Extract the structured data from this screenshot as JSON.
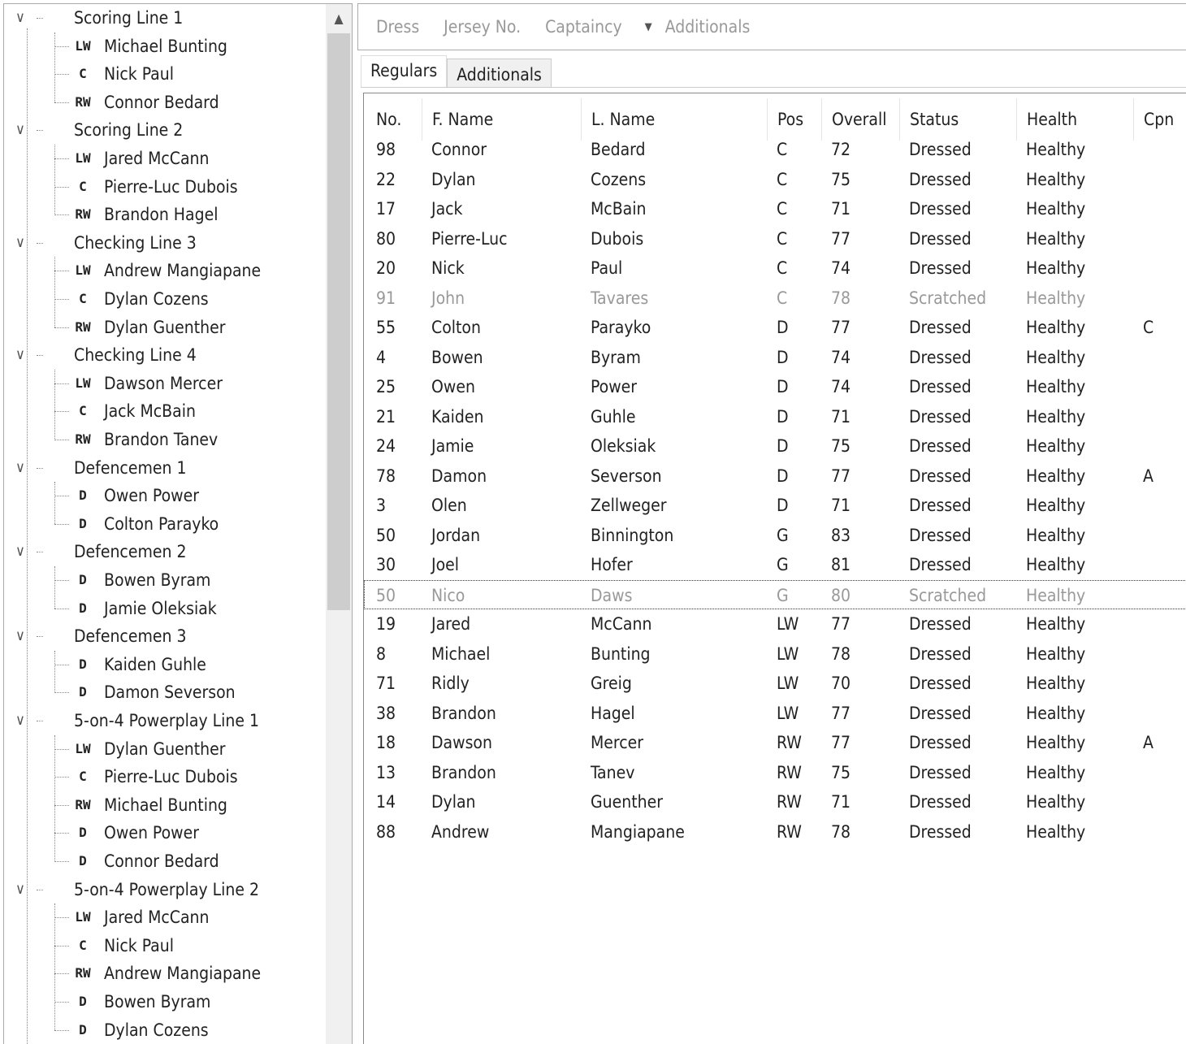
{
  "tree": [
    {
      "group": "Scoring Line 1",
      "players": [
        [
          "LW",
          "Michael Bunting"
        ],
        [
          "C",
          "Nick Paul"
        ],
        [
          "RW",
          "Connor Bedard"
        ]
      ]
    },
    {
      "group": "Scoring Line 2",
      "players": [
        [
          "LW",
          "Jared McCann"
        ],
        [
          "C",
          "Pierre-Luc Dubois"
        ],
        [
          "RW",
          "Brandon Hagel"
        ]
      ]
    },
    {
      "group": "Checking Line 3",
      "players": [
        [
          "LW",
          "Andrew Mangiapane"
        ],
        [
          "C",
          "Dylan Cozens"
        ],
        [
          "RW",
          "Dylan Guenther"
        ]
      ]
    },
    {
      "group": "Checking Line 4",
      "players": [
        [
          "LW",
          "Dawson Mercer"
        ],
        [
          "C",
          "Jack McBain"
        ],
        [
          "RW",
          "Brandon Tanev"
        ]
      ]
    },
    {
      "group": "Defencemen 1",
      "players": [
        [
          "D",
          "Owen Power"
        ],
        [
          "D",
          "Colton Parayko"
        ]
      ]
    },
    {
      "group": "Defencemen 2",
      "players": [
        [
          "D",
          "Bowen Byram"
        ],
        [
          "D",
          "Jamie Oleksiak"
        ]
      ]
    },
    {
      "group": "Defencemen 3",
      "players": [
        [
          "D",
          "Kaiden Guhle"
        ],
        [
          "D",
          "Damon Severson"
        ]
      ]
    },
    {
      "group": "5-on-4 Powerplay Line 1",
      "players": [
        [
          "LW",
          "Dylan Guenther"
        ],
        [
          "C",
          "Pierre-Luc Dubois"
        ],
        [
          "RW",
          "Michael Bunting"
        ],
        [
          "D",
          "Owen Power"
        ],
        [
          "D",
          "Connor Bedard"
        ]
      ]
    },
    {
      "group": "5-on-4 Powerplay Line 2",
      "players": [
        [
          "LW",
          "Jared McCann"
        ],
        [
          "C",
          "Nick Paul"
        ],
        [
          "RW",
          "Andrew Mangiapane"
        ],
        [
          "D",
          "Bowen Byram"
        ],
        [
          "D",
          "Dylan Cozens"
        ]
      ]
    }
  ],
  "toolbar": {
    "dress": "Dress",
    "jersey": "Jersey No.",
    "captaincy": "Captaincy",
    "additionals": "Additionals"
  },
  "tabs": [
    "Regulars",
    "Additionals"
  ],
  "columns": [
    "No.",
    "F. Name",
    "L. Name",
    "Pos",
    "Overall",
    "Status",
    "Health",
    "Cpn"
  ],
  "rows": [
    [
      "98",
      "Connor",
      "Bedard",
      "C",
      "72",
      "Dressed",
      "Healthy",
      ""
    ],
    [
      "22",
      "Dylan",
      "Cozens",
      "C",
      "75",
      "Dressed",
      "Healthy",
      ""
    ],
    [
      "17",
      "Jack",
      "McBain",
      "C",
      "71",
      "Dressed",
      "Healthy",
      ""
    ],
    [
      "80",
      "Pierre-Luc",
      "Dubois",
      "C",
      "77",
      "Dressed",
      "Healthy",
      ""
    ],
    [
      "20",
      "Nick",
      "Paul",
      "C",
      "74",
      "Dressed",
      "Healthy",
      ""
    ],
    [
      "91",
      "John",
      "Tavares",
      "C",
      "78",
      "Scratched",
      "Healthy",
      ""
    ],
    [
      "55",
      "Colton",
      "Parayko",
      "D",
      "77",
      "Dressed",
      "Healthy",
      "C"
    ],
    [
      "4",
      "Bowen",
      "Byram",
      "D",
      "74",
      "Dressed",
      "Healthy",
      ""
    ],
    [
      "25",
      "Owen",
      "Power",
      "D",
      "74",
      "Dressed",
      "Healthy",
      ""
    ],
    [
      "21",
      "Kaiden",
      "Guhle",
      "D",
      "71",
      "Dressed",
      "Healthy",
      ""
    ],
    [
      "24",
      "Jamie",
      "Oleksiak",
      "D",
      "75",
      "Dressed",
      "Healthy",
      ""
    ],
    [
      "78",
      "Damon",
      "Severson",
      "D",
      "77",
      "Dressed",
      "Healthy",
      "A"
    ],
    [
      "3",
      "Olen",
      "Zellweger",
      "D",
      "71",
      "Dressed",
      "Healthy",
      ""
    ],
    [
      "50",
      "Jordan",
      "Binnington",
      "G",
      "83",
      "Dressed",
      "Healthy",
      ""
    ],
    [
      "30",
      "Joel",
      "Hofer",
      "G",
      "81",
      "Dressed",
      "Healthy",
      ""
    ],
    [
      "50",
      "Nico",
      "Daws",
      "G",
      "80",
      "Scratched",
      "Healthy",
      ""
    ],
    [
      "19",
      "Jared",
      "McCann",
      "LW",
      "77",
      "Dressed",
      "Healthy",
      ""
    ],
    [
      "8",
      "Michael",
      "Bunting",
      "LW",
      "78",
      "Dressed",
      "Healthy",
      ""
    ],
    [
      "71",
      "Ridly",
      "Greig",
      "LW",
      "70",
      "Dressed",
      "Healthy",
      ""
    ],
    [
      "38",
      "Brandon",
      "Hagel",
      "LW",
      "77",
      "Dressed",
      "Healthy",
      ""
    ],
    [
      "18",
      "Dawson",
      "Mercer",
      "RW",
      "77",
      "Dressed",
      "Healthy",
      "A"
    ],
    [
      "13",
      "Brandon",
      "Tanev",
      "RW",
      "75",
      "Dressed",
      "Healthy",
      ""
    ],
    [
      "14",
      "Dylan",
      "Guenther",
      "RW",
      "71",
      "Dressed",
      "Healthy",
      ""
    ],
    [
      "88",
      "Andrew",
      "Mangiapane",
      "RW",
      "78",
      "Dressed",
      "Healthy",
      ""
    ]
  ]
}
